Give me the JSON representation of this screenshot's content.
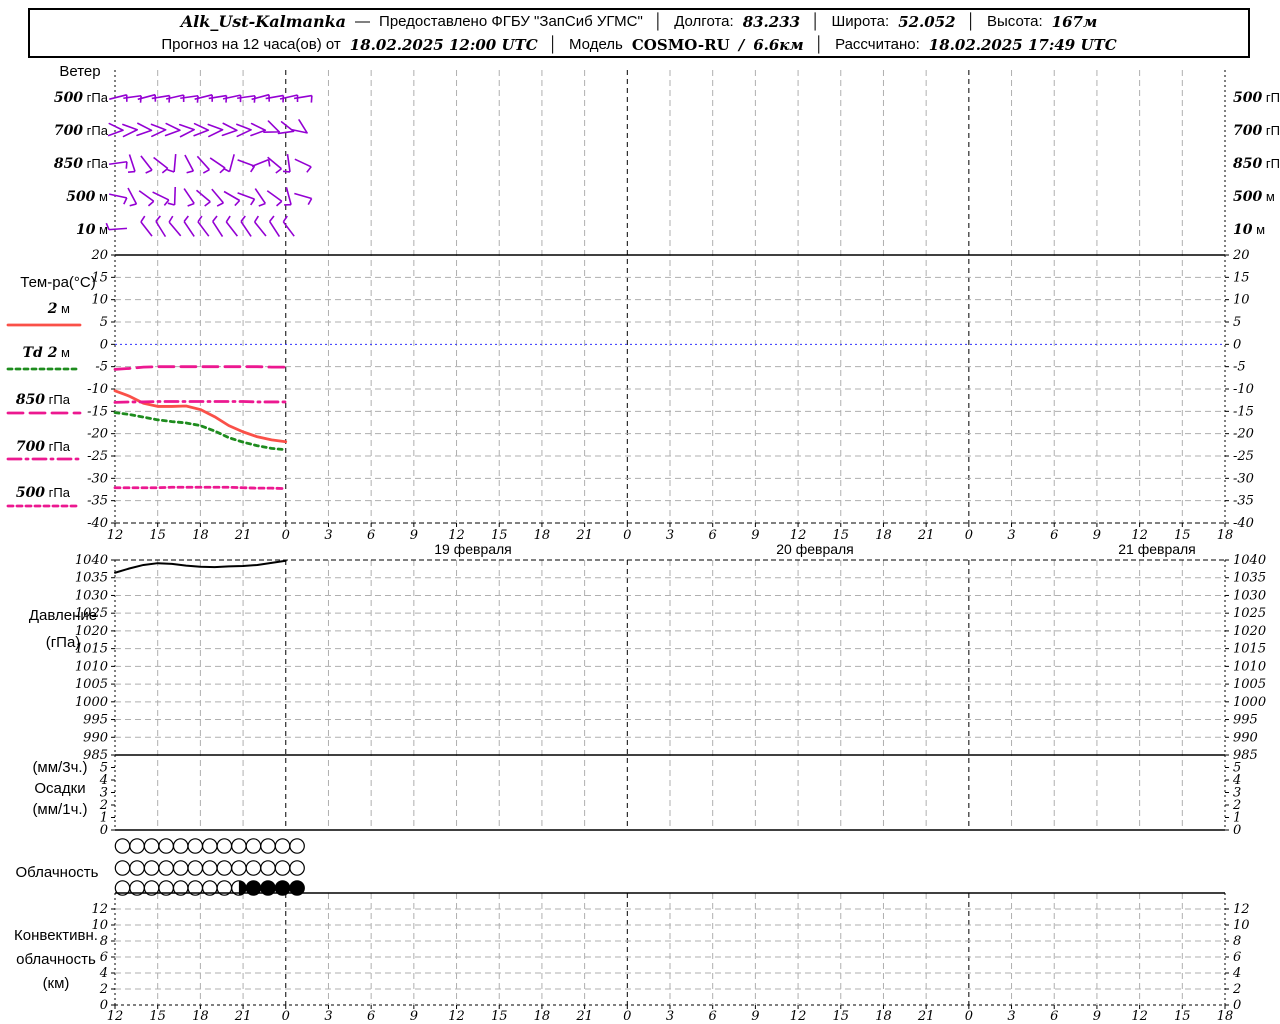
{
  "header": {
    "station": "Alk_Ust-Kalmanka",
    "dash": "—",
    "provider": "Предоставлено ФГБУ \"ЗапСиб УГМС\"",
    "sep": "│",
    "lon_label": "Долгота:",
    "lon": "83.233",
    "lat_label": "Широта:",
    "lat": "52.052",
    "alt_label": "Высота:",
    "alt": "167м",
    "forecast_label": "Прогноз на 12 часа(ов) от",
    "forecast_time": "18.02.2025 12:00 UTC",
    "model_label": "Модель",
    "model_name": "COSMO-RU",
    "model_sep": "/",
    "model_res": "6.6км",
    "calc_label": "Рассчитано:",
    "calc_time": "18.02.2025 17:49 UTC"
  },
  "colors": {
    "barb": "#9400d3",
    "t2m": "#fa5048",
    "td2m": "#1e8c1e",
    "magenta": "#ec1890",
    "zero_line": "#3333ff",
    "grid": "#afafaf",
    "axis": "#000000"
  },
  "time_axis": {
    "labels": [
      "12",
      "15",
      "18",
      "21",
      "0",
      "3",
      "6",
      "9",
      "12",
      "15",
      "18",
      "21",
      "0",
      "3",
      "6",
      "9",
      "12",
      "15",
      "18",
      "21",
      "0",
      "3",
      "6",
      "9",
      "12",
      "15",
      "18"
    ],
    "step_hours": 3,
    "dates": [
      "19 февраля",
      "20 февраля",
      "21 февраля"
    ]
  },
  "chart_data": [
    {
      "id": "wind",
      "type": "barbs",
      "title": "Ветер",
      "levels": [
        {
          "num": "500",
          "unit": "гПа",
          "glyph": "barb",
          "feather": "head",
          "angles": [
            -14,
            -8,
            -15,
            -9,
            -13,
            -8,
            -14,
            -9,
            -12,
            -8,
            -15,
            -10,
            -13,
            -9
          ]
        },
        {
          "num": "700",
          "unit": "гПа",
          "glyph": "chev",
          "feather": "head",
          "angles": [
            3,
            -3,
            4,
            -2,
            3,
            -4,
            2,
            -3,
            4,
            -2,
            3,
            22,
            15,
            35
          ]
        },
        {
          "num": "850",
          "unit": "гПа",
          "glyph": "barb",
          "feather": "head",
          "angles": [
            -8,
            72,
            52,
            38,
            95,
            62,
            48,
            34,
            105,
            20,
            -22,
            40,
            82,
            25
          ]
        },
        {
          "num": "500",
          "unit": "м",
          "glyph": "barb",
          "feather": "head",
          "angles": [
            12,
            62,
            36,
            26,
            92,
            56,
            40,
            50,
            30,
            20,
            56,
            36,
            75,
            16
          ]
        },
        {
          "num": "10",
          "unit": "м",
          "glyph": "barb",
          "feather": "tail",
          "angles": [
            -4,
            null,
            52,
            58,
            50,
            56,
            53,
            57,
            52,
            56,
            51,
            57,
            53,
            null
          ]
        }
      ]
    },
    {
      "id": "temperature",
      "type": "line",
      "ylabel": "Тем-ра(°C)",
      "ylim": [
        -40,
        20
      ],
      "yticks": [
        20,
        15,
        10,
        5,
        0,
        -5,
        -10,
        -15,
        -20,
        -25,
        -30,
        -35,
        -40
      ],
      "x_hours": [
        12,
        13,
        14,
        15,
        16,
        17,
        18,
        19,
        20,
        21,
        22,
        23,
        24
      ],
      "series": [
        {
          "name_num": "2",
          "name_unit": "м",
          "color": "#fa5048",
          "dash": "solid",
          "values": [
            -10.4,
            -11.6,
            -13.2,
            -13.9,
            -13.9,
            -13.8,
            -14.6,
            -16.2,
            -18.2,
            -19.6,
            -20.7,
            -21.4,
            -21.8
          ]
        },
        {
          "name_num": "Td 2",
          "name_unit": "м",
          "color": "#1e8c1e",
          "dash": "4,4",
          "values": [
            -15.3,
            -15.7,
            -16.3,
            -16.9,
            -17.3,
            -17.6,
            -18.2,
            -19.4,
            -20.9,
            -21.9,
            -22.7,
            -23.3,
            -23.6
          ]
        },
        {
          "name_num": "850",
          "name_unit": "гПа",
          "color": "#ec1890",
          "dash": "15,7",
          "values": [
            -5.6,
            -5.4,
            -5.1,
            -5.0,
            -5.0,
            -5.0,
            -5.0,
            -5.0,
            -5.0,
            -5.0,
            -5.0,
            -5.1,
            -5.1
          ]
        },
        {
          "name_num": "700",
          "name_unit": "гПа",
          "color": "#ec1890",
          "dash": "13,5,2,5",
          "values": [
            -13.0,
            -12.9,
            -12.9,
            -12.8,
            -12.8,
            -12.8,
            -12.8,
            -12.8,
            -12.8,
            -12.8,
            -12.9,
            -12.9,
            -12.9
          ]
        },
        {
          "name_num": "500",
          "name_unit": "гПа",
          "color": "#ec1890",
          "dash": "5,4",
          "values": [
            -32.1,
            -32.1,
            -32.1,
            -32.1,
            -32.0,
            -32.0,
            -32.0,
            -32.0,
            -32.0,
            -32.1,
            -32.2,
            -32.2,
            -32.3
          ]
        }
      ]
    },
    {
      "id": "pressure",
      "type": "line",
      "ylabel_lines": [
        "Давление",
        "(гПа)"
      ],
      "ylim": [
        985,
        1040
      ],
      "yticks": [
        1040,
        1035,
        1030,
        1025,
        1020,
        1015,
        1010,
        1005,
        1000,
        995,
        990,
        985
      ],
      "x_hours": [
        12,
        13,
        14,
        15,
        16,
        17,
        18,
        19,
        20,
        21,
        22,
        23,
        24
      ],
      "series": [
        {
          "name": "Давление",
          "color": "#000000",
          "dash": "solid",
          "values": [
            1036.4,
            1037.6,
            1038.6,
            1039.1,
            1038.9,
            1038.4,
            1038.1,
            1038.0,
            1038.2,
            1038.3,
            1038.6,
            1039.2,
            1039.8
          ]
        }
      ]
    },
    {
      "id": "precip",
      "type": "bar",
      "ylabel_lines": [
        "(мм/3ч.)",
        "Осадки",
        "(мм/1ч.)"
      ],
      "ylim": [
        0,
        6
      ],
      "yticks": [
        5,
        4,
        3,
        2,
        1,
        0
      ],
      "values": []
    },
    {
      "id": "clouds",
      "type": "cloud-cover",
      "ylabel": "Облачность",
      "rows": [
        [
          "o",
          "o",
          "o",
          "o",
          "o",
          "o",
          "o",
          "o",
          "o",
          "o",
          "o",
          "o",
          "o"
        ],
        [
          "o",
          "o",
          "o",
          "o",
          "o",
          "o",
          "o",
          "o",
          "o",
          "o",
          "o",
          "o",
          "o"
        ],
        [
          "o",
          "o",
          "o",
          "o",
          "o",
          "o",
          "o",
          "o",
          "h",
          "f",
          "f",
          "f",
          "f"
        ]
      ]
    },
    {
      "id": "convective",
      "type": "line",
      "ylabel_lines": [
        "Конвективн.",
        "облачность",
        "(км)"
      ],
      "ylim": [
        0,
        14
      ],
      "yticks": [
        12,
        10,
        8,
        6,
        4,
        2,
        0
      ],
      "values": []
    }
  ]
}
